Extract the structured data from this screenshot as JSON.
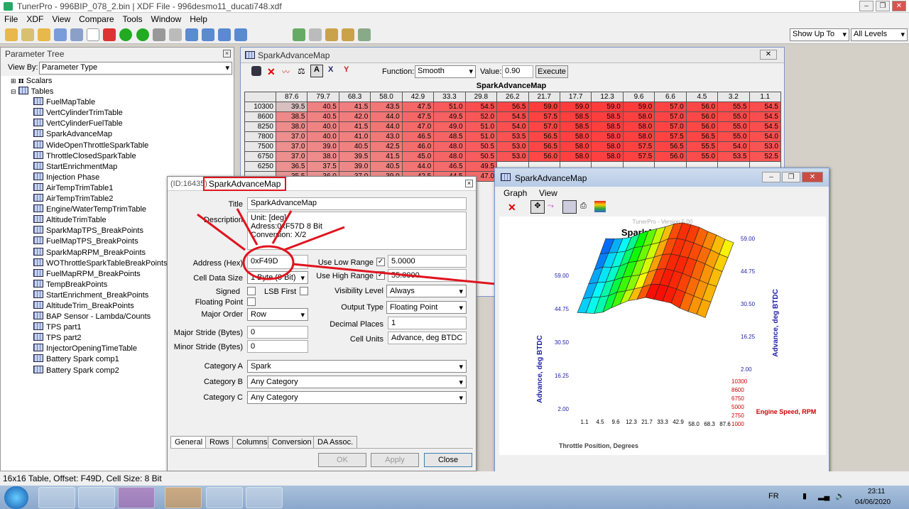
{
  "app": {
    "title": "TunerPro - 996BIP_078_2.bin | XDF File - 996desmo11_ducati748.xdf"
  },
  "menu": [
    "File",
    "XDF",
    "View",
    "Compare",
    "Tools",
    "Window",
    "Help"
  ],
  "toolbar": {
    "show_up_to": "Show Up To",
    "levels": "All Levels"
  },
  "tree": {
    "header": "Parameter Tree",
    "view_by_label": "View By:",
    "view_by_value": "Parameter Type",
    "scalars": "Scalars",
    "tables": "Tables",
    "items": [
      "FuelMapTable",
      "VertCylinderTrimTable",
      "VertCylinderFuelTable",
      "SparkAdvanceMap",
      "WideOpenThrottleSparkTable",
      "ThrottleClosedSparkTable",
      "StartEnrichmentMap",
      "Injection Phase",
      "AirTempTrimTable1",
      "AirTempTrimTable2",
      "Engine/WaterTempTrimTable",
      "AltitudeTrimTable",
      "SparkMapTPS_BreakPoints",
      "FuelMapTPS_BreakPoints",
      "SparkMapRPM_BreakPoints",
      "WOThrottleSparkTableBreakPoints",
      "FuelMapRPM_BreakPoints",
      "TempBreakPoints",
      "StartEnrichment_BreakPoints",
      "AltitudeTrim_BreakPoints",
      "BAP Sensor - Lambda/Counts",
      "TPS part1",
      "TPS part2",
      "InjectorOpeningTimeTable",
      "Battery Spark comp1",
      "Battery Spark comp2"
    ]
  },
  "spark": {
    "title": "SparkAdvanceMap",
    "function_label": "Function:",
    "function_value": "Smooth",
    "value_label": "Value:",
    "value": "0.90",
    "execute": "Execute",
    "table_title": "SparkAdvanceMap",
    "cols": [
      "87.6",
      "79.7",
      "68.3",
      "58.0",
      "42.9",
      "33.3",
      "29.8",
      "26.2",
      "21.7",
      "17.7",
      "12.3",
      "9.6",
      "6.6",
      "4.5",
      "3.2",
      "1.1"
    ],
    "rows": [
      {
        "rpm": "10300",
        "v": [
          "39.5",
          "40.5",
          "41.5",
          "43.5",
          "47.5",
          "51.0",
          "54.5",
          "56.5",
          "59.0",
          "59.0",
          "59.0",
          "59.0",
          "57.0",
          "56.0",
          "55.5",
          "54.5"
        ]
      },
      {
        "rpm": "8600",
        "v": [
          "38.5",
          "40.5",
          "42.0",
          "44.0",
          "47.5",
          "49.5",
          "52.0",
          "54.5",
          "57.5",
          "58.5",
          "58.5",
          "58.0",
          "57.0",
          "56.0",
          "55.0",
          "54.5"
        ]
      },
      {
        "rpm": "8250",
        "v": [
          "38.0",
          "40.0",
          "41.5",
          "44.0",
          "47.0",
          "49.0",
          "51.0",
          "54.0",
          "57.0",
          "58.5",
          "58.5",
          "58.0",
          "57.0",
          "56.0",
          "55.0",
          "54.5"
        ]
      },
      {
        "rpm": "7800",
        "v": [
          "37.0",
          "40.0",
          "41.0",
          "43.0",
          "46.5",
          "48.5",
          "51.0",
          "53.5",
          "56.5",
          "58.0",
          "58.0",
          "58.0",
          "57.5",
          "56.5",
          "55.0",
          "54.0"
        ]
      },
      {
        "rpm": "7500",
        "v": [
          "37.0",
          "39.0",
          "40.5",
          "42.5",
          "46.0",
          "48.0",
          "50.5",
          "53.0",
          "56.5",
          "58.0",
          "58.0",
          "57.5",
          "56.5",
          "55.5",
          "54.0",
          "53.0"
        ]
      },
      {
        "rpm": "6750",
        "v": [
          "37.0",
          "38.0",
          "39.5",
          "41.5",
          "45.0",
          "48.0",
          "50.5",
          "53.0",
          "56.0",
          "58.0",
          "58.0",
          "57.5",
          "56.0",
          "55.0",
          "53.5",
          "52.5"
        ]
      },
      {
        "rpm": "6250",
        "v": [
          "36.5",
          "37.5",
          "39.0",
          "40.5",
          "44.0",
          "46.5",
          "49.5",
          "",
          "",
          "",
          "",
          "",
          "",
          "",
          "",
          ""
        ]
      },
      {
        "rpm": "",
        "v": [
          "35.5",
          "36.0",
          "37.0",
          "39.0",
          "42.5",
          "44.5",
          "47.0",
          "",
          "",
          "",
          "",
          "",
          "",
          "",
          "",
          ""
        ]
      }
    ]
  },
  "dialog": {
    "id_label": "(ID:16435)",
    "title": "SparkAdvanceMap",
    "title_label": "Title",
    "title_value": "SparkAdvanceMap",
    "desc_label": "Description",
    "desc_lines": [
      "Unit: [deg]",
      "Adress:0xF57D 8 Bit",
      "Conversion: X/2"
    ],
    "address_label": "Address (Hex)",
    "address": "0xF49D",
    "cell_size_label": "Cell Data Size",
    "cell_size": "1 Byte (8 Bit)",
    "signed": "Signed",
    "lsb_first": "LSB First",
    "floating_point": "Floating Point",
    "major_order_label": "Major Order",
    "major_order": "Row",
    "major_stride_label": "Major Stride (Bytes)",
    "major_stride": "0",
    "minor_stride_label": "Minor Stride (Bytes)",
    "minor_stride": "0",
    "use_low_range": "Use Low Range",
    "low_range": "5.0000",
    "use_high_range": "Use High Range",
    "high_range": "55.0000",
    "visibility_label": "Visibility Level",
    "visibility": "Always",
    "output_type_label": "Output Type",
    "output_type": "Floating Point",
    "decimal_label": "Decimal Places",
    "decimal": "1",
    "cell_units_label": "Cell Units",
    "cell_units": "Advance, deg BTDC",
    "cat_a_label": "Category A",
    "cat_a": "Spark",
    "cat_b_label": "Category B",
    "cat_b": "Any Category",
    "cat_c_label": "Category C",
    "cat_c": "Any Category",
    "tabs": [
      "General",
      "Rows",
      "Columns",
      "Conversion",
      "DA Assoc."
    ],
    "ok": "OK",
    "apply": "Apply",
    "close": "Close"
  },
  "graph": {
    "title": "SparkAdvanceMap",
    "menu": [
      "Graph",
      "View"
    ],
    "version": "TunerPro - Version 5.00",
    "chart_title": "SparkAdvanceMap",
    "y_label": "Advance, deg BTDC",
    "x_label": "Throttle Position, Degrees",
    "z_label": "Engine Speed, RPM",
    "y_ticks": [
      "2.00",
      "16.25",
      "30.50",
      "44.75",
      "59.00"
    ],
    "x_ticks": [
      "1.1",
      "4.5",
      "9.6",
      "12.3",
      "21.7",
      "33.3",
      "42.9",
      "58.0",
      "68.3",
      "87.6"
    ],
    "rpm_ticks": [
      "10300",
      "8600",
      "6750",
      "5000",
      "2750",
      "1000"
    ]
  },
  "status": {
    "text": "16x16 Table, Offset: F49D,  Cell Size: 8 Bit"
  },
  "taskbar": {
    "lang": "FR",
    "time": "23:11",
    "date": "04/06/2020"
  }
}
